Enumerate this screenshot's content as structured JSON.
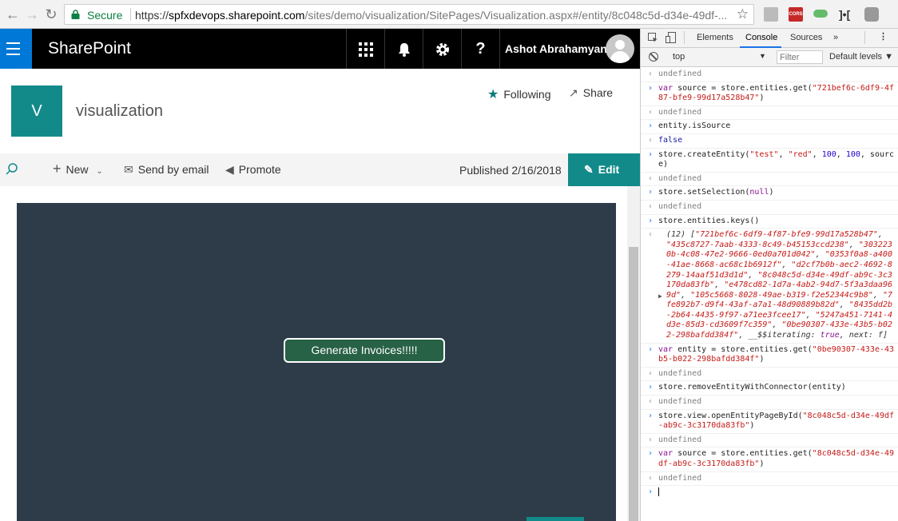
{
  "browser": {
    "secure_label": "Secure",
    "url_prefix": "https://",
    "url_host": "spfxdevops.sharepoint.com",
    "url_path": "/sites/demo/visualization/SitePages/Visualization.aspx#/entity/8c048c5d-d34e-49df-...",
    "icons": [
      "back-icon",
      "forward-icon",
      "reload-icon",
      "lock-icon",
      "star-icon"
    ],
    "extensions": [
      "pdf-icon",
      "cors-icon",
      "toggle-icon",
      "bracket-icon",
      "shield-icon"
    ],
    "cors_label": "CORS"
  },
  "suitebar": {
    "brand": "SharePoint",
    "user_name": "Ashot Abrahamyan",
    "icons": [
      "waffle-icon",
      "app-launcher-icon",
      "bell-icon",
      "gear-icon",
      "help-icon"
    ],
    "help_glyph": "?"
  },
  "site": {
    "logo_letter": "V",
    "title": "visualization",
    "following_label": "Following",
    "share_label": "Share"
  },
  "commandbar": {
    "new_label": "New",
    "send_label": "Send by email",
    "promote_label": "Promote",
    "published": "Published 2/16/2018",
    "edit_label": "Edit"
  },
  "canvas": {
    "button_label": "Generate Invoices!!!!!",
    "background": "#2e3c49",
    "button_color": "#276146"
  },
  "devtools": {
    "tabs": [
      "Elements",
      "Console",
      "Sources"
    ],
    "more_tabs_glyph": "»",
    "active_tab": "Console",
    "context": "top",
    "filter_placeholder": "Filter",
    "levels": "Default levels ▼",
    "console_lines": [
      {
        "type": "res",
        "text": "undefined"
      },
      {
        "type": "cmd",
        "text": "var source = store.entities.get(\"721bef6c-6df9-4f87-bfe9-99d17a528b47\")"
      },
      {
        "type": "res",
        "text": "undefined"
      },
      {
        "type": "cmd",
        "text": "entity.isSource"
      },
      {
        "type": "res",
        "text": "false"
      },
      {
        "type": "cmd",
        "text": "store.createEntity(\"test\", \"red\", 100, 100, source)"
      },
      {
        "type": "res",
        "text": "undefined"
      },
      {
        "type": "cmd",
        "text": "store.setSelection(null)"
      },
      {
        "type": "res",
        "text": "undefined"
      },
      {
        "type": "cmd",
        "text": "store.entities.keys()"
      },
      {
        "type": "arr",
        "count": "(12)",
        "items": [
          "721bef6c-6df9-4f87-bfe9-99d17a528b47",
          "435c8727-7aab-4333-8c49-b45153ccd238",
          "3032230b-4c08-47e2-9666-0ed0a701d042",
          "0353f0a8-a400-41ae-8668-ac68c1b6912f",
          "d2cf7b0b-aec2-4692-8279-14aaf51d3d1d",
          "8c048c5d-d34e-49df-ab9c-3c3170da83fb",
          "e478cd82-1d7a-4ab2-94d7-5f3a3daa969d",
          "105c5668-8028-49ae-b319-f2e52344c9b8",
          "7fe892b7-d9f4-43af-a7a1-48d90889b82d",
          "8435dd2b-2b64-4435-9f97-a71ee3fcee17",
          "5247a451-7141-4d3e-85d3-cd3609f7c359",
          "0be90307-433e-43b5-b022-298bafdd384f"
        ],
        "tail": ", __$$iterating: true, next: f]"
      },
      {
        "type": "cmd",
        "text": "var entity = store.entities.get(\"0be90307-433e-43b5-b022-298bafdd384f\")"
      },
      {
        "type": "res",
        "text": "undefined"
      },
      {
        "type": "cmd",
        "text": "store.removeEntityWithConnector(entity)"
      },
      {
        "type": "res",
        "text": "undefined"
      },
      {
        "type": "cmd",
        "text": "store.view.openEntityPageById(\"8c048c5d-d34e-49df-ab9c-3c3170da83fb\")"
      },
      {
        "type": "res",
        "text": "undefined"
      },
      {
        "type": "cmd",
        "text": "var source = store.entities.get(\"8c048c5d-d34e-49df-ab9c-3c3170da83fb\")"
      },
      {
        "type": "res",
        "text": "undefined"
      }
    ]
  }
}
